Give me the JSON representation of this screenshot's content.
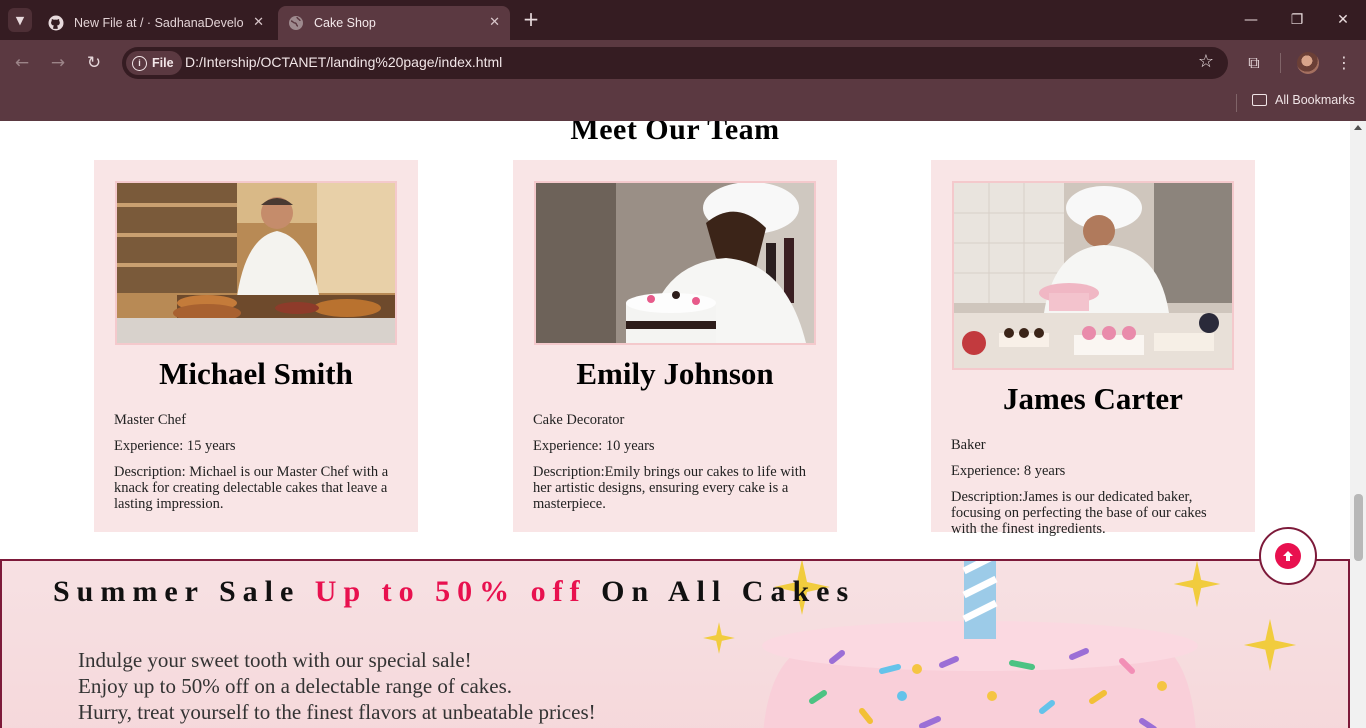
{
  "browser": {
    "tabs": [
      {
        "title": "New File at / · SadhanaDevelop",
        "icon": "github-icon"
      },
      {
        "title": "Cake Shop",
        "icon": "globe-icon"
      }
    ],
    "chip_label": "File",
    "url": "D:/Intership/OCTANET/landing%20page/index.html",
    "bookmarks_label": "All Bookmarks"
  },
  "page": {
    "team_title": "Meet Our Team",
    "members": [
      {
        "name": "Michael Smith",
        "role": "Master Chef",
        "experience": "Experience: 15 years",
        "description": "Description: Michael is our Master Chef with a knack for creating delectable cakes that leave a lasting impression."
      },
      {
        "name": "Emily Johnson",
        "role": "Cake Decorator",
        "experience": "Experience: 10 years",
        "description": "Description:Emily brings our cakes to life with her artistic designs, ensuring every cake is a masterpiece."
      },
      {
        "name": "James Carter",
        "role": "Baker",
        "experience": "Experience: 8 years",
        "description": "Description:James is our dedicated baker, focusing on perfecting the base of our cakes with the finest ingredients."
      }
    ],
    "sale": {
      "title_start": "Summer Sale ",
      "title_highlight": "Up to 50% off",
      "title_end": " On All Cakes",
      "lines": [
        "Indulge your sweet tooth with our special sale!",
        "Enjoy up to 50% off on a delectable range of cakes.",
        "Hurry, treat yourself to the finest flavors at unbeatable prices!"
      ]
    },
    "colors": {
      "accent": "#e8114f",
      "card_bg": "#f9e5e6",
      "border": "#7d1a3a"
    }
  }
}
